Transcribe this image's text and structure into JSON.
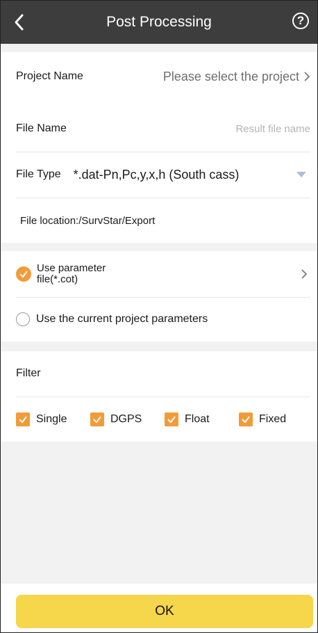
{
  "header": {
    "title": "Post Processing",
    "help_glyph": "?"
  },
  "project": {
    "label": "Project Name",
    "value": "Please select the project"
  },
  "file": {
    "name_label": "File Name",
    "name_placeholder": "Result file name",
    "type_label": "File Type",
    "type_value": "*.dat-Pn,Pc,y,x,h (South cass)",
    "location": "File location:/SurvStar/Export"
  },
  "parameters": {
    "option1": "Use parameter file(*.cot)",
    "option1_line1": "Use parameter",
    "option1_line2": "file(*.cot)",
    "option1_selected": true,
    "option2": "Use the current project parameters",
    "option2_selected": false
  },
  "filter": {
    "label": "Filter",
    "items": [
      {
        "label": "Single",
        "checked": true
      },
      {
        "label": "DGPS",
        "checked": true
      },
      {
        "label": "Float",
        "checked": true
      },
      {
        "label": "Fixed",
        "checked": true
      }
    ]
  },
  "ok_label": "OK",
  "colors": {
    "header_bg": "#3d3d3d",
    "accent_orange": "#f39b37",
    "ok_button": "#f6d64a",
    "page_bg": "#f2f2f2"
  }
}
